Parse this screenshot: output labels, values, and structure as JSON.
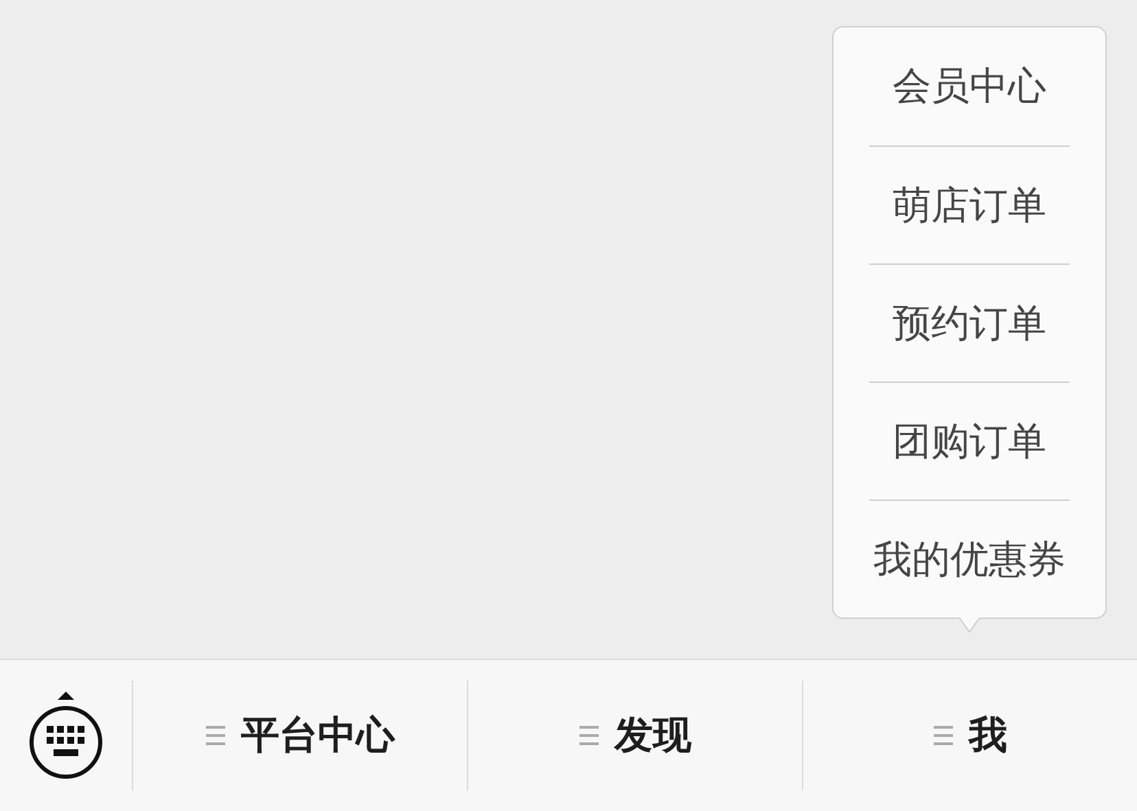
{
  "popup_menu": {
    "items": [
      "会员中心",
      "萌店订单",
      "预约订单",
      "团购订单",
      "我的优惠券"
    ]
  },
  "bottom_bar": {
    "tabs": [
      {
        "label": "平台中心"
      },
      {
        "label": "发现"
      },
      {
        "label": "我"
      }
    ]
  }
}
